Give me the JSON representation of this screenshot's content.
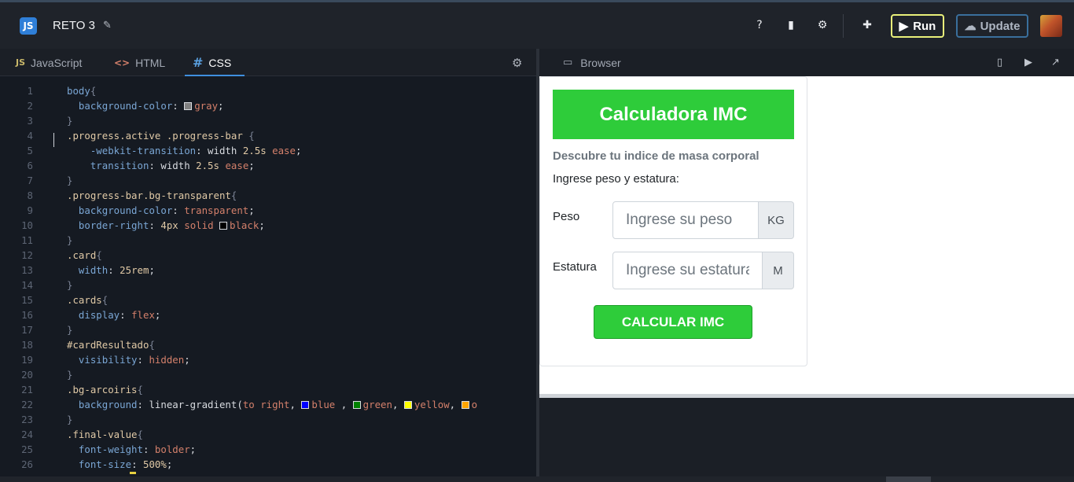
{
  "header": {
    "logo_text": "JS",
    "project_title": "RETO 3",
    "run_label": "Run",
    "update_label": "Update",
    "icons": [
      "help-icon",
      "document-icon",
      "gear-icon",
      "puzzle-icon"
    ]
  },
  "editor": {
    "tabs": [
      {
        "icon": "JS",
        "label": "JavaScript",
        "active": false
      },
      {
        "icon": "<>",
        "label": "HTML",
        "active": false
      },
      {
        "icon": "#",
        "label": "CSS",
        "active": true
      }
    ],
    "line_numbers": [
      "1",
      "2",
      "3",
      "4",
      "5",
      "6",
      "7",
      "8",
      "9",
      "10",
      "11",
      "12",
      "13",
      "14",
      "15",
      "16",
      "17",
      "18",
      "19",
      "20",
      "21",
      "22",
      "23",
      "24",
      "25",
      "26"
    ]
  },
  "browser": {
    "panel_label": "Browser",
    "app": {
      "title": "Calculadora IMC",
      "subtitle": "Descubre tu indice de masa corporal",
      "instruction": "Ingrese peso y estatura:",
      "peso_label": "Peso",
      "peso_placeholder": "Ingrese su peso",
      "peso_unit": "KG",
      "estatura_label": "Estatura",
      "estatura_placeholder": "Ingrese su estatura",
      "estatura_unit": "M",
      "button_label": "CALCULAR IMC"
    }
  },
  "colors": {
    "accent_green": "#2ecc3a",
    "run_border": "#e9f07a",
    "tab_active": "#3f8fde"
  }
}
